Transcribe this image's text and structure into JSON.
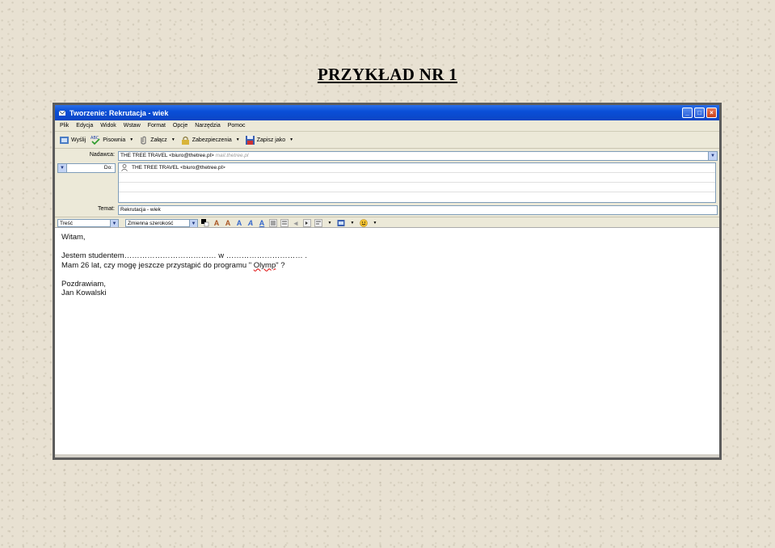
{
  "page": {
    "heading": "PRZYKŁAD NR 1"
  },
  "window": {
    "title": "Tworzenie: Rekrutacja - wiek",
    "controls": {
      "minimize": "_",
      "maximize": "□",
      "close": "×"
    }
  },
  "menu": {
    "items": [
      "Plik",
      "Edycja",
      "Widok",
      "Wstaw",
      "Format",
      "Opcje",
      "Narzędzia",
      "Pomoc"
    ]
  },
  "toolbar": {
    "send": "Wyślij",
    "spelling": "Pisownia",
    "attach": "Załącz",
    "security": "Zabezpieczenia",
    "save_as": "Zapisz jako"
  },
  "compose": {
    "from_label": "Nadawca:",
    "from_value": "THE TREE TRAVEL <biuro@thetree.pl>",
    "from_account": "mail.thetree.pl",
    "to_type": "Do:",
    "to_value": "THE TREE TRAVEL <biuro@thetree.pl>",
    "subject_label": "Temat:",
    "subject_value": "Rekrutacja - wiek"
  },
  "format_bar": {
    "paragraph_style": "Treść",
    "font": "Zmienna szerokość"
  },
  "body": {
    "greeting": "Witam,",
    "line1": "Jestem studentem……………………………… w ………………………… .",
    "line2_pre": "Mam 26 lat, czy mogę jeszcze przystąpić do programu \" ",
    "line2_word": "Olymp",
    "line2_post": "\" ?",
    "closing": "Pozdrawiam,",
    "name": "Jan Kowalski"
  },
  "colors": {
    "titlebar": "#0a4fd8",
    "background": "#e8e1d2"
  }
}
